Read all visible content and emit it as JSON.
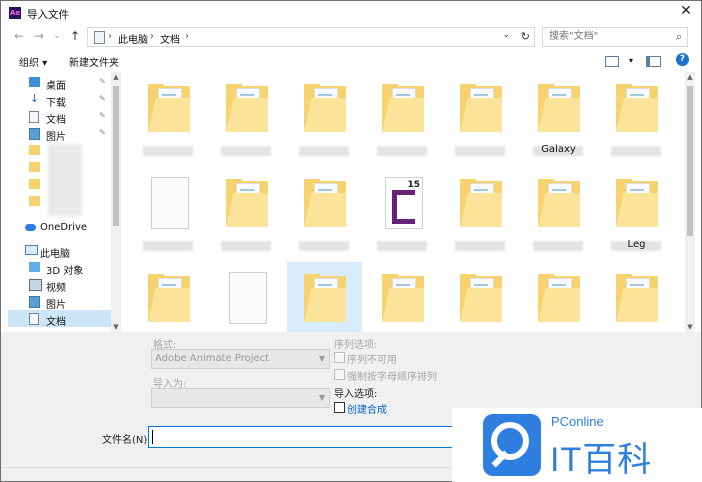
{
  "window": {
    "title": "导入文件",
    "app_icon": "Ae",
    "close_glyph": "✕"
  },
  "nav": {
    "back": "←",
    "forward": "→",
    "dropdown": "⌄",
    "up": "↑",
    "breadcrumb": [
      "此电脑",
      "文档"
    ],
    "separator": "›",
    "refresh": "↻",
    "search_placeholder": "搜索\"文档\""
  },
  "commands": {
    "organize": "组织 ▾",
    "new_folder": "新建文件夹"
  },
  "sidebar": {
    "items": [
      {
        "label": "桌面",
        "icon": "desktop-icon",
        "pinned": true
      },
      {
        "label": "下载",
        "icon": "download-icon",
        "pinned": true
      },
      {
        "label": "文档",
        "icon": "document-icon",
        "pinned": true
      },
      {
        "label": "图片",
        "icon": "picture-icon",
        "pinned": true
      },
      {
        "label": "",
        "icon": "folder-icon",
        "pinned": false
      },
      {
        "label": "",
        "icon": "folder-icon",
        "pinned": false
      },
      {
        "label": "201",
        "icon": "folder-icon",
        "pinned": false
      },
      {
        "label": "",
        "icon": "folder-icon",
        "pinned": false
      },
      {
        "label": "OneDrive",
        "icon": "cloud-icon",
        "pinned": false
      },
      {
        "label": "此电脑",
        "icon": "computer-icon",
        "pinned": false
      },
      {
        "label": "3D 对象",
        "icon": "3d-objects-icon",
        "pinned": false
      },
      {
        "label": "视频",
        "icon": "video-icon",
        "pinned": false
      },
      {
        "label": "图片",
        "icon": "picture-icon",
        "pinned": false
      },
      {
        "label": "文档",
        "icon": "document-icon",
        "pinned": false
      }
    ],
    "pin_glyph": "📌"
  },
  "files": [
    {
      "kind": "folder",
      "label": ""
    },
    {
      "kind": "folder",
      "label": ""
    },
    {
      "kind": "folder",
      "label": ""
    },
    {
      "kind": "folder",
      "label": ""
    },
    {
      "kind": "folder",
      "label": ""
    },
    {
      "kind": "folder",
      "label": "Galaxy"
    },
    {
      "kind": "folder",
      "label": ""
    },
    {
      "kind": "doc",
      "label": ""
    },
    {
      "kind": "folder",
      "label": ""
    },
    {
      "kind": "folder",
      "label": ""
    },
    {
      "kind": "vs-folder",
      "label": ""
    },
    {
      "kind": "folder",
      "label": ""
    },
    {
      "kind": "folder",
      "label": ""
    },
    {
      "kind": "folder",
      "label": "Leg"
    },
    {
      "kind": "folder",
      "label": ""
    },
    {
      "kind": "doc",
      "label": ""
    },
    {
      "kind": "folder",
      "label": ""
    },
    {
      "kind": "folder",
      "label": ""
    },
    {
      "kind": "folder",
      "label": ""
    },
    {
      "kind": "folder",
      "label": ""
    },
    {
      "kind": "folder",
      "label": ""
    }
  ],
  "options": {
    "format_label": "格式:",
    "format_value": "Adobe Animate Project",
    "import_as_label": "导入为:",
    "import_as_value": "",
    "sequence_options_label": "序列选项:",
    "sequence_unavailable": "序列不可用",
    "force_alpha_order": "强制按字母顺序排列",
    "import_options_label": "导入选项:",
    "create_composition": "创建合成",
    "filename_label": "文件名(N):",
    "filename_value": ""
  },
  "watermark": {
    "brand": "PConline",
    "title": "IT百科"
  },
  "colors": {
    "accent": "#0078d7",
    "folder": "#f7d36e",
    "selection": "#cde6f7",
    "brand_blue": "#2f7fe0"
  }
}
